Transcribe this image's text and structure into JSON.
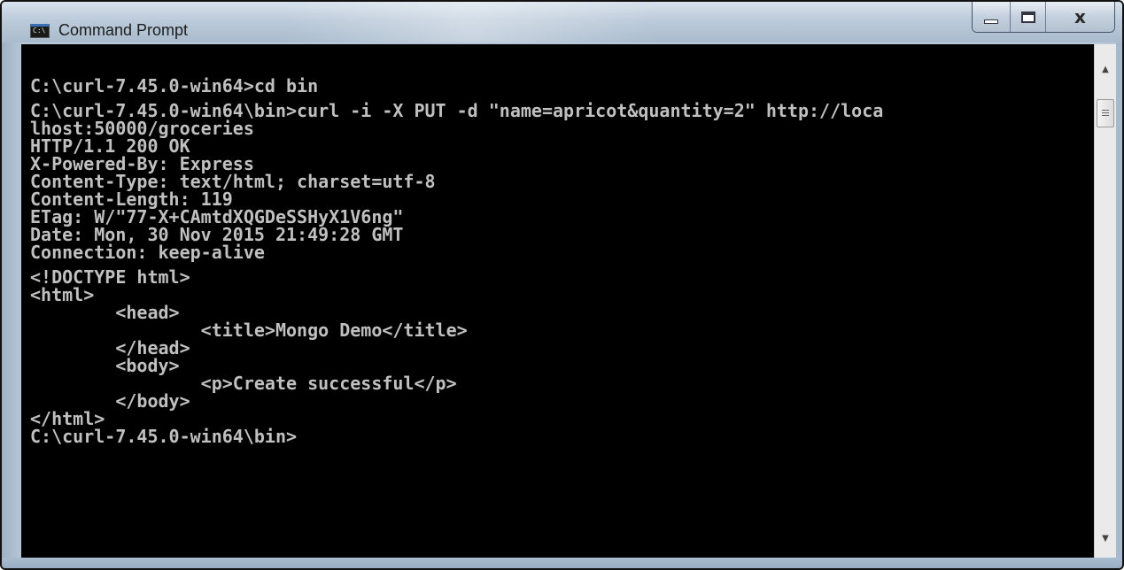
{
  "window": {
    "title": "Command Prompt",
    "icon": "cmd-icon",
    "controls": {
      "minimize": "minimize-icon",
      "maximize": "maximize-icon",
      "close": "x"
    }
  },
  "console": {
    "background": "#000000",
    "foreground": "#c0c0c0",
    "lines": [
      "C:\\curl-7.45.0-win64>cd bin",
      "",
      "C:\\curl-7.45.0-win64\\bin>curl -i -X PUT -d \"name=apricot&quantity=2\" http://loca",
      "lhost:50000/groceries",
      "HTTP/1.1 200 OK",
      "X-Powered-By: Express",
      "Content-Type: text/html; charset=utf-8",
      "Content-Length: 119",
      "ETag: W/\"77-X+CAmtdXQGDeSSHyX1V6ng\"",
      "Date: Mon, 30 Nov 2015 21:49:28 GMT",
      "Connection: keep-alive",
      "",
      "<!DOCTYPE html>",
      "<html>",
      "        <head>",
      "                <title>Mongo Demo</title>",
      "        </head>",
      "        <body>",
      "                <p>Create successful</p>",
      "        </body>",
      "</html>",
      "C:\\curl-7.45.0-win64\\bin>"
    ]
  },
  "scrollbar": {
    "up_icon": "scroll-up-arrow-icon",
    "down_icon": "scroll-down-arrow-icon"
  }
}
